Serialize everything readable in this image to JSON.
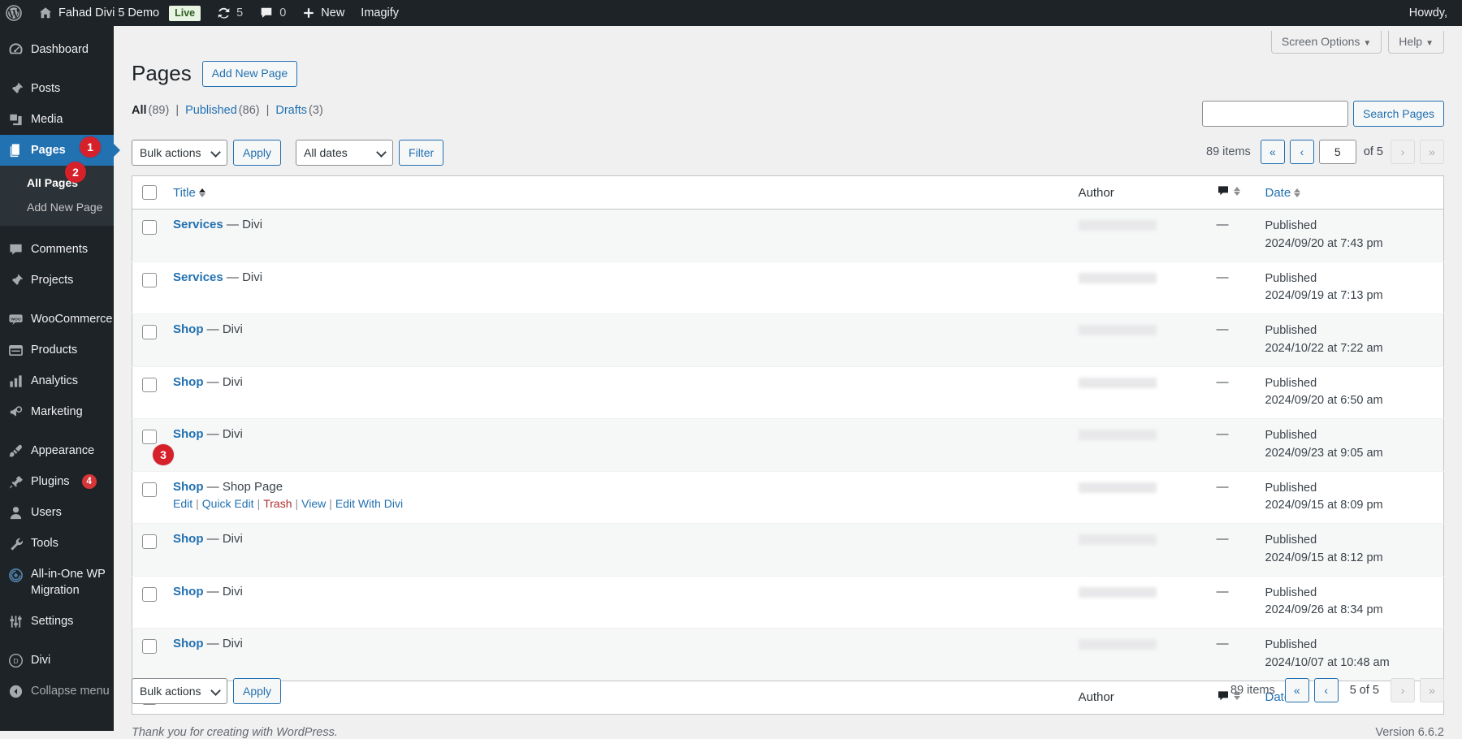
{
  "adminbar": {
    "wp_logo_icon": "wordpress-logo-icon",
    "site_home_icon": "home-icon",
    "site_name": "Fahad Divi 5 Demo",
    "live_badge": "Live",
    "updates_icon": "updates-icon",
    "updates_count": "5",
    "comments_icon": "comment-bubble-icon",
    "comments_count": "0",
    "new_icon": "plus-icon",
    "new_label": "New",
    "imagify_label": "Imagify",
    "howdy": "Howdy,"
  },
  "sidebar": {
    "items": [
      {
        "label": "Dashboard",
        "icon": "dashboard-icon",
        "name": "dashboard"
      },
      {
        "label": "Posts",
        "icon": "pin-icon",
        "name": "posts"
      },
      {
        "label": "Media",
        "icon": "media-icon",
        "name": "media"
      },
      {
        "label": "Pages",
        "icon": "pages-icon",
        "name": "pages",
        "current": true
      },
      {
        "label": "Comments",
        "icon": "comment-icon",
        "name": "comments"
      },
      {
        "label": "Projects",
        "icon": "pin-icon",
        "name": "projects"
      },
      {
        "label": "WooCommerce",
        "icon": "woocommerce-icon",
        "name": "woocommerce"
      },
      {
        "label": "Products",
        "icon": "products-icon",
        "name": "products"
      },
      {
        "label": "Analytics",
        "icon": "analytics-icon",
        "name": "analytics"
      },
      {
        "label": "Marketing",
        "icon": "megaphone-icon",
        "name": "marketing"
      },
      {
        "label": "Appearance",
        "icon": "paintbrush-icon",
        "name": "appearance"
      },
      {
        "label": "Plugins",
        "icon": "plug-icon",
        "name": "plugins",
        "badge": "4"
      },
      {
        "label": "Users",
        "icon": "user-icon",
        "name": "users"
      },
      {
        "label": "Tools",
        "icon": "wrench-icon",
        "name": "tools"
      },
      {
        "label": "All-in-One WP Migration",
        "icon": "aiowpm-icon",
        "name": "all-in-one-wp-migration"
      },
      {
        "label": "Settings",
        "icon": "settings-icon",
        "name": "settings"
      },
      {
        "label": "Divi",
        "icon": "divi-icon",
        "name": "divi"
      },
      {
        "label": "Collapse menu",
        "icon": "collapse-icon",
        "name": "collapse-menu"
      }
    ],
    "submenu": [
      {
        "label": "All Pages",
        "current": true
      },
      {
        "label": "Add New Page",
        "current": false
      }
    ]
  },
  "markers": {
    "one": "1",
    "two": "2",
    "three": "3"
  },
  "screen_meta": {
    "screen_options": "Screen Options",
    "help": "Help",
    "caret": "▼"
  },
  "header": {
    "title": "Pages",
    "add_new": "Add New Page"
  },
  "views": {
    "all_label": "All",
    "all_count": "(89)",
    "published_label": "Published",
    "published_count": "(86)",
    "drafts_label": "Drafts",
    "drafts_count": "(3)",
    "separator": "|"
  },
  "search": {
    "value": "",
    "placeholder": "",
    "button": "Search Pages"
  },
  "tablenav_top": {
    "bulk_actions": "Bulk actions",
    "apply": "Apply",
    "all_dates": "All dates",
    "filter": "Filter",
    "items_count": "89 items",
    "first_page": "«",
    "prev_page": "‹",
    "current_page": "5",
    "of_total": "of 5",
    "next_page": "›",
    "last_page": "»"
  },
  "tablenav_bottom": {
    "bulk_actions": "Bulk actions",
    "apply": "Apply",
    "items_count": "89 items",
    "first_page": "«",
    "prev_page": "‹",
    "page_status": "5 of 5",
    "next_page": "›",
    "last_page": "»"
  },
  "table": {
    "columns": {
      "title": "Title",
      "author": "Author",
      "comments_icon": "comment-bubble-icon",
      "date": "Date"
    },
    "rows": [
      {
        "title": "Services",
        "suffix": " — Divi",
        "author": "",
        "comments": "—",
        "status": "Published",
        "date": "2024/09/20 at 7:43 pm",
        "actions": []
      },
      {
        "title": "Services",
        "suffix": " — Divi",
        "author": "",
        "comments": "—",
        "status": "Published",
        "date": "2024/09/19 at 7:13 pm",
        "actions": []
      },
      {
        "title": "Shop",
        "suffix": " — Divi",
        "author": "",
        "comments": "—",
        "status": "Published",
        "date": "2024/10/22 at 7:22 am",
        "actions": []
      },
      {
        "title": "Shop",
        "suffix": " — Divi",
        "author": "",
        "comments": "—",
        "status": "Published",
        "date": "2024/09/20 at 6:50 am",
        "actions": []
      },
      {
        "title": "Shop",
        "suffix": " — Divi",
        "author": "",
        "comments": "—",
        "status": "Published",
        "date": "2024/09/23 at 9:05 am",
        "actions": []
      },
      {
        "title": "Shop",
        "suffix": " — Shop Page",
        "author": "",
        "comments": "—",
        "status": "Published",
        "date": "2024/09/15 at 8:09 pm",
        "actions": [
          "Edit",
          "Quick Edit",
          "Trash",
          "View",
          "Edit With Divi"
        ]
      },
      {
        "title": "Shop",
        "suffix": " — Divi",
        "author": "",
        "comments": "—",
        "status": "Published",
        "date": "2024/09/15 at 8:12 pm",
        "actions": []
      },
      {
        "title": "Shop",
        "suffix": " — Divi",
        "author": "",
        "comments": "—",
        "status": "Published",
        "date": "2024/09/26 at 8:34 pm",
        "actions": []
      },
      {
        "title": "Shop",
        "suffix": " — Divi",
        "author": "",
        "comments": "—",
        "status": "Published",
        "date": "2024/10/07 at 10:48 am",
        "actions": []
      }
    ]
  },
  "footer": {
    "thanks_prefix": "Thank you for creating with ",
    "wordpress_link": "WordPress",
    "thanks_suffix": ".",
    "version": "Version 6.6.2"
  }
}
